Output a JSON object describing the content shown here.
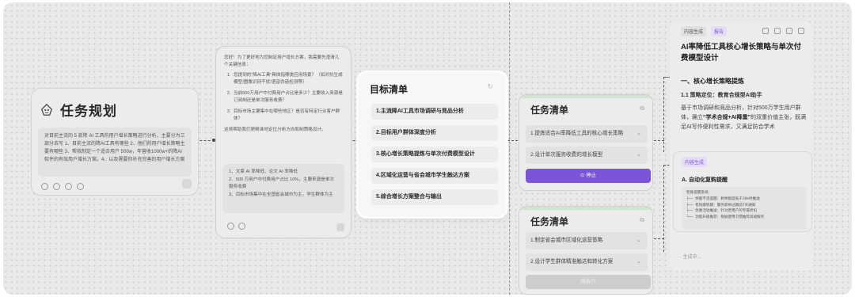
{
  "task_planning": {
    "title": "任务规划",
    "description": "对目前主流的 5 款降 AI 工具的用户增长策略进行分析，主要分为三部分去写 1、目前主流的降AI工具有哪些 2、他们的用户增长策略主要有哪些 3、帮我制定一个适合用户 500w，年营收1000w+的降AI软件的有效用户增长方案。4、以及需要你补充完善的用户增长方案"
  },
  "questions": {
    "intro": "您好！为了更好地为您制定用户增长方案，我需要先澄清几个关键信息：",
    "items": [
      "您提到的“降AI工具”具体指哪类应用场景？（如对抗生成模型/图像识别干扰/语音伪造检测等）",
      "当前500万用户中付费用户占比是多少？主要收入来源是订阅制还是单次服务收费？",
      "目标市场主要集中在哪些地区？是否有特定行业客户群体？"
    ],
    "outro": "这将帮助我们更精准地定位分析方向和制策略设计。",
    "answer": "1、文章 AI 率降低、论文 AI 率降低\n2、500 万用户中付费用户占比 10%，主要来源是单次服务收费\n3、目标市场集中在全国省会城市为主，学生群体为主"
  },
  "goal_list": {
    "title": "目标清单",
    "items": [
      "1.主流降AI工具市场调研与竞品分析",
      "2.目标用户群体深度分析",
      "3.核心增长策略提炼与单次付费模型设计",
      "4.区域化运营与省会城市学生触达方案",
      "5.综合增长方案整合与输出"
    ]
  },
  "task_list_1": {
    "title": "任务清单",
    "items": [
      "1.提炼适合AI率降低工具的核心增长策略",
      "2.设计单次服务收费的增长模型"
    ],
    "button": "停止"
  },
  "task_list_2": {
    "title": "任务清单",
    "items": [
      "1.制定省会城市区域化运营策略",
      "2.设计学生群体精准触达和转化方案"
    ],
    "button": "待执行"
  },
  "content_panel": {
    "tag_content": "内容生成",
    "tag_report": "报告",
    "title": "AI率降低工具核心增长策略与单次付费模型设计",
    "h1": "一、核心增长策略提炼",
    "h2": "1.1 策略定位：教育合规型AI助手",
    "para_prefix": "基于市场调研和竞品分析，针对500万学生用户群体，确立",
    "para_bold": "“学术合规+AI降重”",
    "para_suffix": "的双重价值主张，既满足AI写作便利性需求，又满足防合学术"
  },
  "sub_content": {
    "tag": "内容生成",
    "heading": "A. 自动化复购提醒",
    "code": "智能提醒系统：\n├── 余额不足提醒：剩余额度低于20%时推送\n├── 有效期到期：服务即将过期前7天通知\n├── 优惠活动推送：针对老用户的专属折扣\n└── 功能升级推荐：根据使用习惯推荐高级服务"
  },
  "generating": "··· 生成中..."
}
